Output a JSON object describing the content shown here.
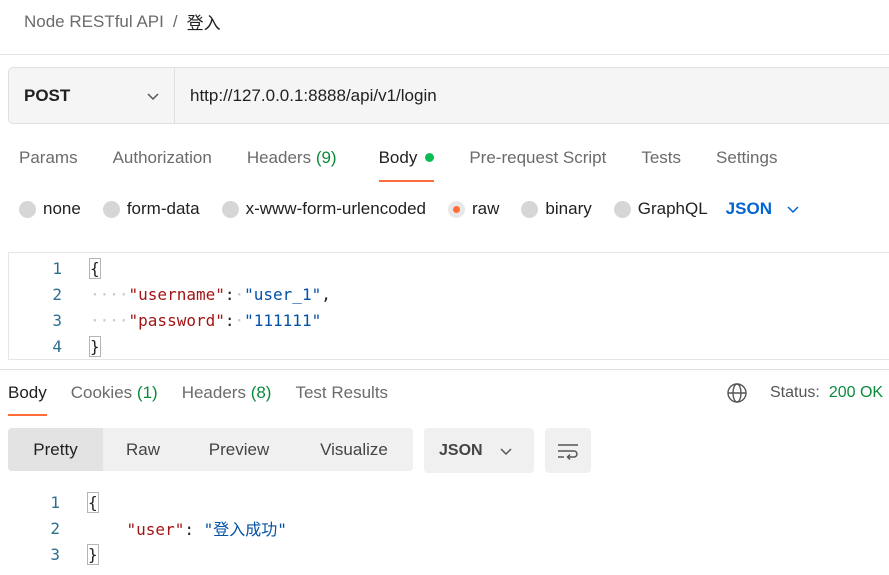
{
  "breadcrumb": {
    "parent": "Node RESTful API",
    "separator": "/",
    "current": "登入"
  },
  "request": {
    "method": "POST",
    "url": "http://127.0.0.1:8888/api/v1/login",
    "tabs": [
      {
        "label": "Params"
      },
      {
        "label": "Authorization"
      },
      {
        "label": "Headers",
        "count": "(9)"
      },
      {
        "label": "Body"
      },
      {
        "label": "Pre-request Script"
      },
      {
        "label": "Tests"
      },
      {
        "label": "Settings"
      }
    ],
    "active_tab": "Body",
    "body_types": [
      "none",
      "form-data",
      "x-www-form-urlencoded",
      "raw",
      "binary",
      "GraphQL"
    ],
    "selected_body_type": "raw",
    "format": "JSON",
    "editor": {
      "line_numbers": [
        "1",
        "2",
        "3",
        "4"
      ],
      "open_brace": "{",
      "close_brace": "}",
      "key1": "\"username\"",
      "val1": "\"user_1\"",
      "key2": "\"password\"",
      "val2": "\"111111\""
    }
  },
  "response": {
    "tabs": [
      {
        "label": "Body"
      },
      {
        "label": "Cookies",
        "count": "(1)"
      },
      {
        "label": "Headers",
        "count": "(8)"
      },
      {
        "label": "Test Results"
      }
    ],
    "active_tab": "Body",
    "status_label": "Status:",
    "status_value": "200 OK",
    "view_modes": [
      "Pretty",
      "Raw",
      "Preview",
      "Visualize"
    ],
    "selected_view": "Pretty",
    "format": "JSON",
    "code": {
      "line_numbers": [
        "1",
        "2",
        "3"
      ],
      "open_brace": "{",
      "close_brace": "}",
      "key": "\"user\"",
      "value": "\"登入成功\""
    }
  },
  "colors": {
    "accent": "#ff6c37",
    "success": "#0b8a3c",
    "link": "#0265d2"
  },
  "icons": [
    "chevron-down-icon",
    "globe-icon",
    "wrap-lines-icon"
  ]
}
